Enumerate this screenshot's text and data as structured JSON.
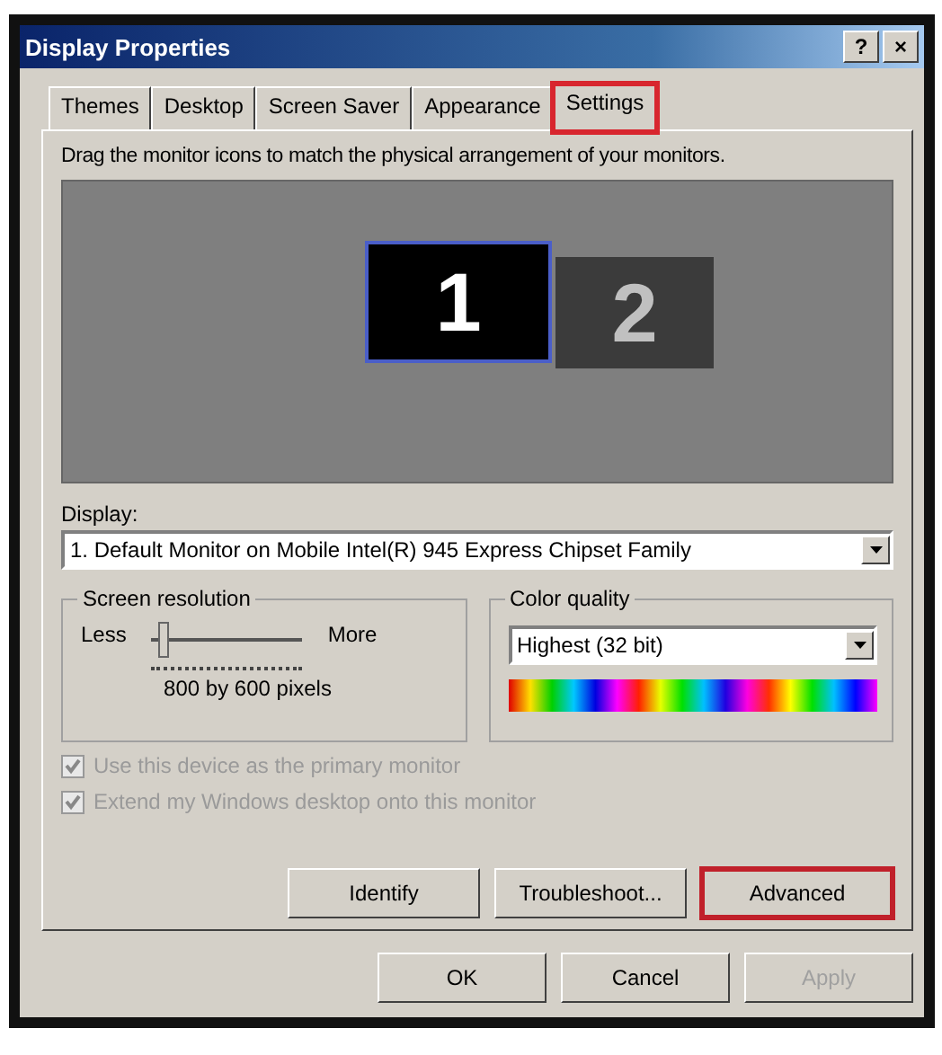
{
  "window": {
    "title": "Display Properties",
    "help_button": "?",
    "close_button": "×"
  },
  "tabs": [
    {
      "label": "Themes",
      "selected": false,
      "highlighted": false
    },
    {
      "label": "Desktop",
      "selected": false,
      "highlighted": false
    },
    {
      "label": "Screen Saver",
      "selected": false,
      "highlighted": false
    },
    {
      "label": "Appearance",
      "selected": false,
      "highlighted": false
    },
    {
      "label": "Settings",
      "selected": true,
      "highlighted": true
    }
  ],
  "instruction": "Drag the monitor icons to match the physical arrangement of your monitors.",
  "monitors": [
    {
      "label": "1",
      "selected": true
    },
    {
      "label": "2",
      "selected": false
    }
  ],
  "display": {
    "label": "Display:",
    "value": "1. Default Monitor on Mobile Intel(R) 945 Express Chipset Family"
  },
  "screen_resolution": {
    "title": "Screen resolution",
    "less": "Less",
    "more": "More",
    "level": 0.04,
    "reading": "800 by 600 pixels"
  },
  "color_quality": {
    "title": "Color quality",
    "value": "Highest (32 bit)"
  },
  "checkboxes": [
    {
      "label": "Use this device as the primary monitor",
      "checked": true,
      "disabled": true
    },
    {
      "label": "Extend my Windows desktop onto this monitor",
      "checked": true,
      "disabled": true
    }
  ],
  "panel_buttons": [
    {
      "label": "Identify",
      "highlighted": false
    },
    {
      "label": "Troubleshoot...",
      "highlighted": false
    },
    {
      "label": "Advanced",
      "highlighted": true
    }
  ],
  "dialog_buttons": [
    {
      "label": "OK",
      "disabled": false
    },
    {
      "label": "Cancel",
      "disabled": false
    },
    {
      "label": "Apply",
      "disabled": true
    }
  ]
}
